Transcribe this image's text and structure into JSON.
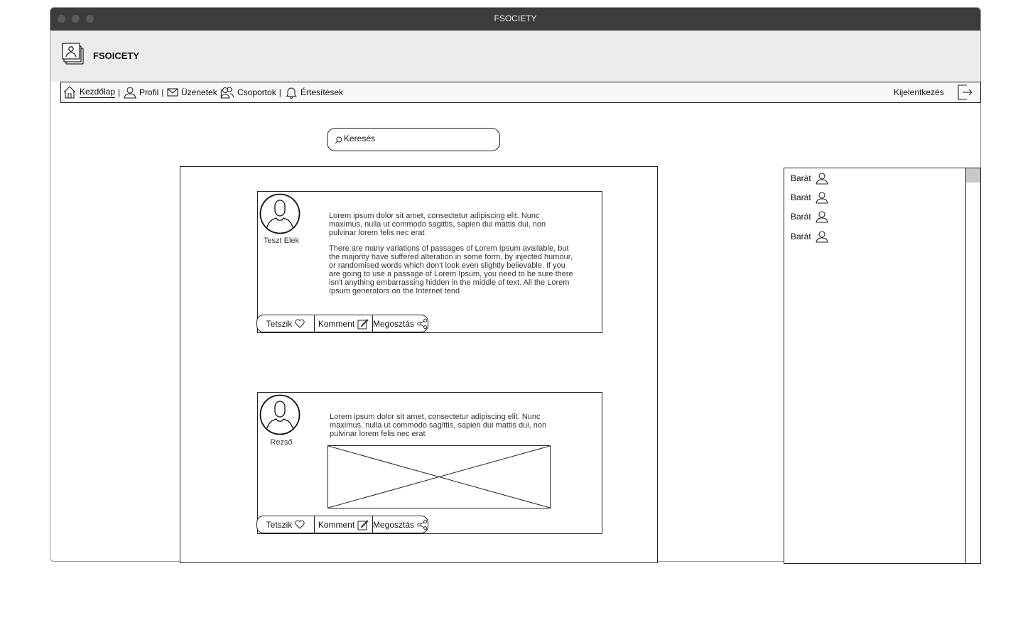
{
  "window": {
    "title": "FSOCIETY"
  },
  "header": {
    "brand": "FSOICETY",
    "logo_icon": "photo-stack-icon"
  },
  "nav": {
    "items": [
      {
        "label": "Kezdőlap",
        "icon": "home-icon",
        "active": true
      },
      {
        "label": "Profil",
        "icon": "user-icon"
      },
      {
        "label": "Üzenetek",
        "icon": "envelope-icon"
      },
      {
        "label": "Csoportok",
        "icon": "users-icon"
      },
      {
        "label": "Értesítések",
        "icon": "bell-icon"
      }
    ],
    "separator": "|",
    "logout_label": "Kijelentkezés",
    "logout_icon": "logout-icon"
  },
  "search": {
    "placeholder": "Keresés"
  },
  "posts": [
    {
      "author": "Teszt Elek",
      "paragraphs": [
        "Lorem ipsum dolor sit amet, consectetur adipiscing elit. Nunc maximus, nulla ut commodo sagittis, sapien dui mattis dui, non pulvinar lorem felis nec erat",
        "There are many variations of passages of Lorem Ipsum available, but the majority have suffered alteration in some form, by injected humour, or randomised words which don't look even slightly believable. If you are going to use a passage of Lorem Ipsum, you need to be sure there isn't anything embarrassing hidden in the middle of text. All the Lorem Ipsum generators on the Internet tend"
      ],
      "actions": {
        "like": "Tetszik",
        "comment": "Komment",
        "share": "Megosztás"
      }
    },
    {
      "author": "Rezső",
      "paragraphs": [
        "Lorem ipsum dolor sit amet, consectetur adipiscing elit. Nunc maximus, nulla ut commodo sagittis, sapien dui mattis dui, non pulvinar lorem felis nec erat"
      ],
      "has_image": true,
      "actions": {
        "like": "Tetszik",
        "comment": "Komment",
        "share": "Megosztás"
      }
    }
  ],
  "friends": {
    "items": [
      "Barát",
      "Barát",
      "Barát",
      "Barát"
    ]
  }
}
